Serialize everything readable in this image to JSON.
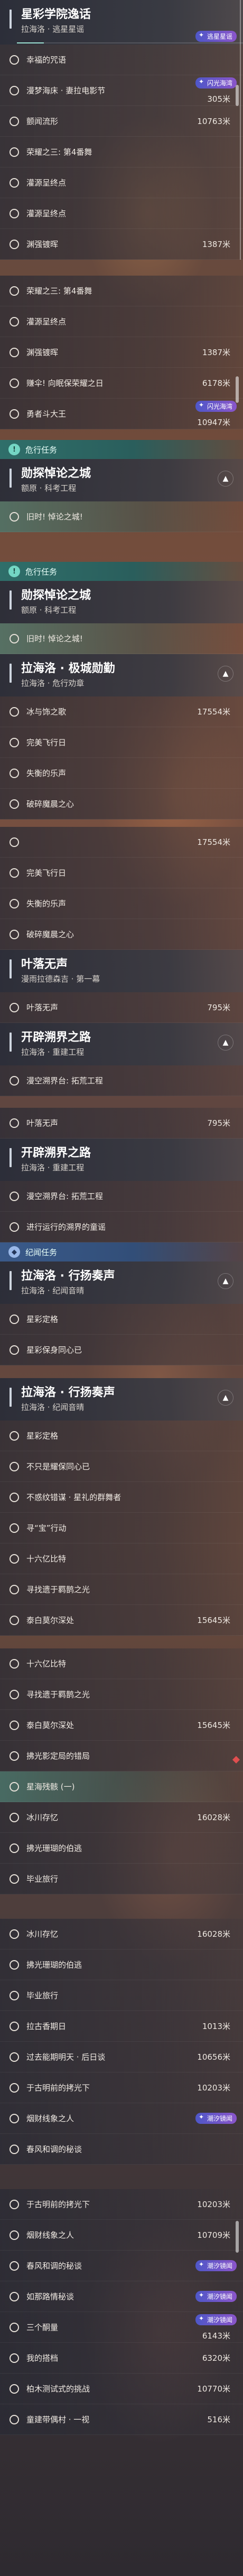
{
  "frame1": {
    "header": {
      "title": "星彩学院逸话",
      "subtitle": "拉海洛 · 逃星星谣"
    },
    "tag": "逃星星谣",
    "rows": [
      {
        "label": "幸福的咒语",
        "dist": ""
      },
      {
        "label": "漫梦海床 · 妻拉电影节",
        "dist": "305米",
        "tag": "闪光海湾"
      },
      {
        "label": "颤闻流形",
        "dist": "10763米"
      },
      {
        "label": "荣耀之三: 第4番舞",
        "dist": ""
      },
      {
        "label": "灌源呈终点",
        "dist": ""
      },
      {
        "label": "灌源呈终点",
        "dist": ""
      },
      {
        "label": "渊强镀晖",
        "dist": "1387米"
      }
    ]
  },
  "frame2": {
    "rows": [
      {
        "label": "荣耀之三: 第4番舞",
        "dist": ""
      },
      {
        "label": "灌源呈终点",
        "dist": ""
      },
      {
        "label": "渊强镀晖",
        "dist": "1387米"
      },
      {
        "label": "赚伞! 向眠保荣耀之日",
        "dist": "6178米"
      },
      {
        "label": "勇者斗大王",
        "dist": "10947米",
        "tag": "闪光海湾"
      }
    ]
  },
  "frame3": {
    "category": "危行任务",
    "header": {
      "title": "勋探悼论之城",
      "subtitle": "额原 · 科考工程"
    },
    "rows": [
      {
        "label": "旧时! 悼论之城!",
        "dist": ""
      }
    ]
  },
  "frame4": {
    "category": "危行任务",
    "header": {
      "title": "勋探悼论之城",
      "subtitle": "额原 · 科考工程"
    },
    "rows": [
      {
        "label": "旧时! 悼论之城!",
        "dist": ""
      }
    ],
    "header2": {
      "title": "拉海洛 · 极城勋勤",
      "subtitle": "拉海洛 · 危行劝章"
    },
    "rows2": [
      {
        "label": "冰与饰之歌",
        "dist": "17554米"
      },
      {
        "label": "完美飞行日",
        "dist": ""
      },
      {
        "label": "失衡的乐声",
        "dist": ""
      },
      {
        "label": "破碎魔晨之心",
        "dist": ""
      }
    ]
  },
  "frame5": {
    "rows": [
      {
        "label": "",
        "dist": "17554米"
      },
      {
        "label": "完美飞行日",
        "dist": ""
      },
      {
        "label": "失衡的乐声",
        "dist": ""
      },
      {
        "label": "破碎魔晨之心",
        "dist": ""
      }
    ],
    "header": {
      "title": "叶落无声",
      "subtitle": "漫雨拉德森吉 · 第一幕"
    },
    "rows2": [
      {
        "label": "叶落无声",
        "dist": "795米"
      }
    ],
    "header2": {
      "title": "开辟溯界之路",
      "subtitle": "拉海洛 · 重建工程"
    },
    "rows3": [
      {
        "label": "漫空溯界台: 拓荒工程",
        "dist": ""
      }
    ]
  },
  "frame6": {
    "rows": [
      {
        "label": "叶落无声",
        "dist": "795米"
      }
    ],
    "header": {
      "title": "开辟溯界之路",
      "subtitle": "拉海洛 · 重建工程"
    },
    "rows2": [
      {
        "label": "漫空溯界台: 拓荒工程",
        "dist": ""
      },
      {
        "label": "进行运行的溯界的童谣",
        "dist": ""
      }
    ],
    "category": "纪闻任务",
    "header2": {
      "title": "拉海洛 · 行扬奏声",
      "subtitle": "拉海洛 · 纪闻音晴"
    },
    "rows3": [
      {
        "label": "星彩定格",
        "dist": ""
      },
      {
        "label": "星彩保身同心已",
        "dist": ""
      }
    ]
  },
  "frame7": {
    "header": {
      "title": "拉海洛 · 行扬奏声",
      "subtitle": "拉海洛 · 纪闻音晴"
    },
    "rows": [
      {
        "label": "星彩定格",
        "dist": ""
      },
      {
        "label": "不只是耀保同心已",
        "dist": ""
      },
      {
        "label": "不惑纹错谋 · 星礼的群舞者",
        "dist": ""
      },
      {
        "label": "寻“宝”行动",
        "dist": ""
      },
      {
        "label": "十六亿比特",
        "dist": ""
      },
      {
        "label": "寻找遗于羁鹊之光",
        "dist": ""
      },
      {
        "label": "泰白莫尔深处",
        "dist": "15645米"
      }
    ]
  },
  "frame8": {
    "rows": [
      {
        "label": "十六亿比特",
        "dist": ""
      },
      {
        "label": "寻找遗于羁鹊之光",
        "dist": ""
      },
      {
        "label": "泰白莫尔深处",
        "dist": "15645米"
      },
      {
        "label": "拂光影定局的错局",
        "dist": ""
      },
      {
        "label": "星海残骸 (一)",
        "dist": ""
      },
      {
        "label": "冰川存忆",
        "dist": "16028米"
      },
      {
        "label": "拂光珊瑚的伯逃",
        "dist": ""
      },
      {
        "label": "毕业旅行",
        "dist": ""
      }
    ]
  },
  "frame9": {
    "rows": [
      {
        "label": "冰川存忆",
        "dist": "16028米"
      },
      {
        "label": "拂光珊瑚的伯逃",
        "dist": ""
      },
      {
        "label": "毕业旅行",
        "dist": ""
      },
      {
        "label": "拉古香期日",
        "dist": "1013米"
      },
      {
        "label": "过去能期明天 · 后日谈",
        "dist": "10656米"
      },
      {
        "label": "于古明前的拷光下",
        "dist": "10203米"
      },
      {
        "label": "烟财线象之人",
        "dist": "",
        "tag": "潮汐镜闻"
      },
      {
        "label": "春风和调的秘谈",
        "dist": ""
      }
    ]
  },
  "frame10": {
    "rows": [
      {
        "label": "于古明前的拷光下",
        "dist": "10203米"
      },
      {
        "label": "烟财线象之人",
        "dist": "10709米"
      },
      {
        "label": "春风和调的秘谈",
        "dist": "",
        "tag": "潮汐镜闻"
      },
      {
        "label": "如那路情秘谈",
        "dist": "",
        "tag": "潮汐镜闻"
      },
      {
        "label": "三个酮量",
        "dist": "6143米",
        "tag": "潮汐镜闻"
      },
      {
        "label": "我的搭档",
        "dist": "6320米"
      },
      {
        "label": "柏木测试式的挑战",
        "dist": "10770米"
      },
      {
        "label": "童建带偶村 · 一视",
        "dist": "516米"
      }
    ]
  }
}
